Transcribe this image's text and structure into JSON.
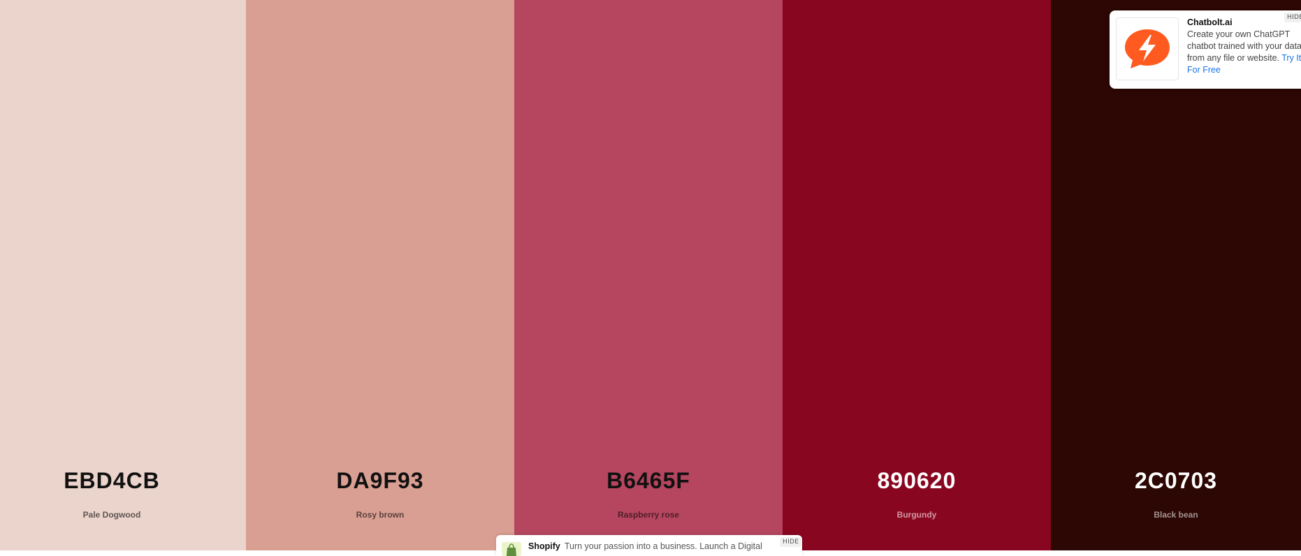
{
  "palette": [
    {
      "hex": "EBD4CB",
      "name": "Pale Dogwood",
      "bg": "#EBD4CB",
      "hex_color": "#111111",
      "name_color": "#5f5452"
    },
    {
      "hex": "DA9F93",
      "name": "Rosy brown",
      "bg": "#DA9F93",
      "hex_color": "#111111",
      "name_color": "#5a413c"
    },
    {
      "hex": "B6465F",
      "name": "Raspberry rose",
      "bg": "#B6465F",
      "hex_color": "#111111",
      "name_color": "#4f1e28"
    },
    {
      "hex": "890620",
      "name": "Burgundy",
      "bg": "#890620",
      "hex_color": "#ffffff",
      "name_color": "#d29aa5"
    },
    {
      "hex": "2C0703",
      "name": "Black bean",
      "bg": "#2C0703",
      "hex_color": "#ffffff",
      "name_color": "#a39593"
    }
  ],
  "ad": {
    "title": "Chatbolt.ai",
    "body": "Create your own ChatGPT chatbot trained with your data from any file or website.",
    "cta": "Try It For Free",
    "hide_label": "HIDE",
    "logo_icon": "lightning-chat-icon",
    "accent": "#ff5a1f"
  },
  "bottom_ad": {
    "brand": "Shopify",
    "text": "Turn your passion into a business. Launch a Digital",
    "hide_label": "HIDE",
    "logo_icon": "shopify-bag-icon"
  }
}
